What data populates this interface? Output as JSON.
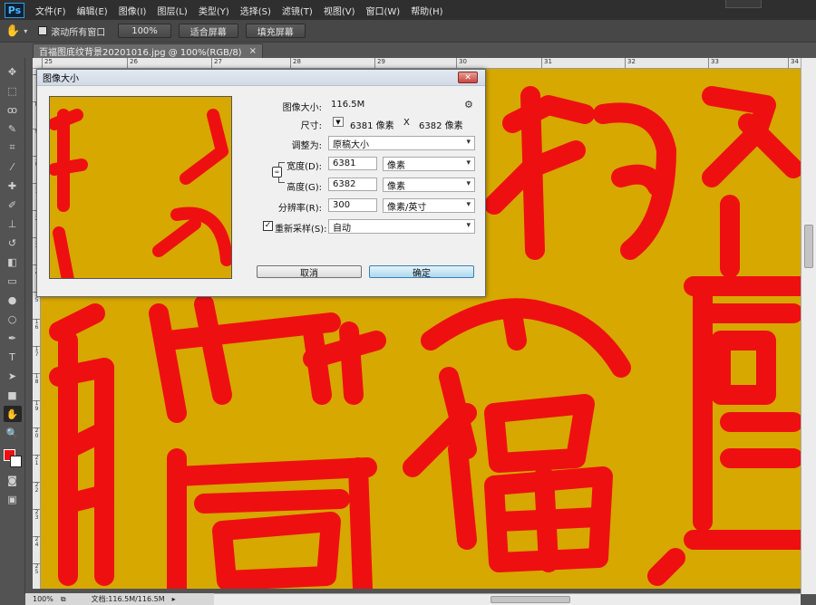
{
  "app": {
    "logo": "Ps"
  },
  "menu": [
    "文件(F)",
    "编辑(E)",
    "图像(I)",
    "图层(L)",
    "类型(Y)",
    "选择(S)",
    "滤镜(T)",
    "视图(V)",
    "窗口(W)",
    "帮助(H)"
  ],
  "options": {
    "scroll_all": "滚动所有窗口",
    "zoom_100": "100%",
    "fit_screen": "适合屏幕",
    "fill_screen": "填充屏幕"
  },
  "document": {
    "tab_title": "百福图底纹背景20201016.jpg @ 100%(RGB/8)"
  },
  "ruler": {
    "h_ticks": [
      "25",
      "26",
      "27",
      "28",
      "29",
      "30",
      "31",
      "32",
      "33",
      "34"
    ],
    "v_ticks": [
      "7",
      "8",
      "9",
      "1 0",
      "1 1",
      "1 2",
      "1 3",
      "1 4",
      "1 5",
      "1 6",
      "1 7",
      "1 8",
      "1 9",
      "2 0",
      "2 1",
      "2 2",
      "2 3",
      "2 4",
      "2 5"
    ]
  },
  "status": {
    "zoom": "100%",
    "doc": "文档:116.5M/116.5M"
  },
  "dialog": {
    "title": "图像大小",
    "image_size_label": "图像大小:",
    "image_size_value": "116.5M",
    "dimensions_label": "尺寸:",
    "dim_w": "6381 像素",
    "dim_x": "X",
    "dim_h": "6382 像素",
    "fit_label": "调整为:",
    "fit_value": "原稿大小",
    "width_label": "宽度(D):",
    "width_value": "6381",
    "width_unit": "像素",
    "height_label": "高度(G):",
    "height_value": "6382",
    "height_unit": "像素",
    "res_label": "分辨率(R):",
    "res_value": "300",
    "res_unit": "像素/英寸",
    "resample_label": "重新采样(S):",
    "resample_value": "自动",
    "cancel": "取消",
    "ok": "确定"
  },
  "colors": {
    "canvas_bg": "#d6a800",
    "ink": "#ee1010",
    "foreground": "#ee1010",
    "background": "#ffffff"
  }
}
